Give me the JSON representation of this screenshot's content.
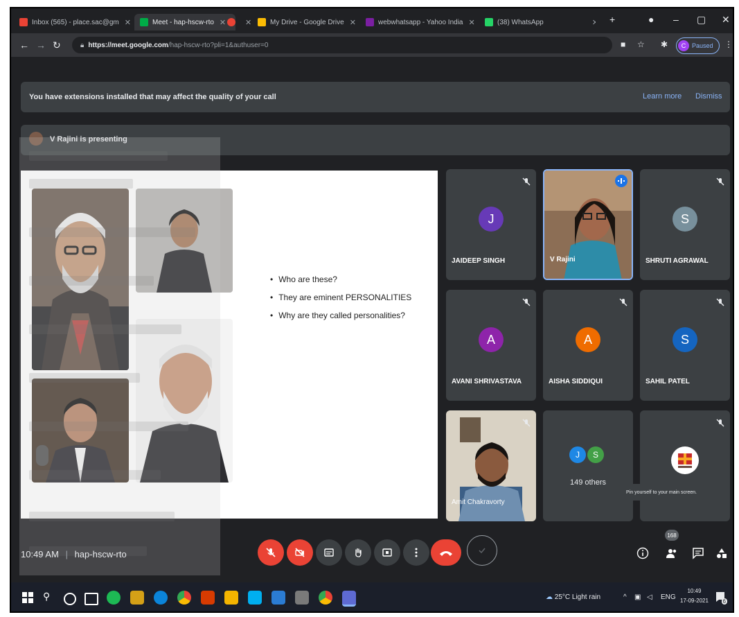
{
  "browser": {
    "tabs": [
      {
        "label": "Inbox (565) - place.sac@gm",
        "color": "#ea4335"
      },
      {
        "label": "Meet - hap-hscw-rto",
        "color": "#00ac47"
      },
      {
        "label": "",
        "color": "#ea4335"
      },
      {
        "label": "My Drive - Google Drive",
        "color": "#fbbc04"
      },
      {
        "label": "webwhatsapp - Yahoo India",
        "color": "#7b1fa2"
      },
      {
        "label": "(38) WhatsApp",
        "color": "#25d366"
      }
    ],
    "url_host": "https://meet.google.com",
    "url_path": "/hap-hscw-rto?pli=1&authuser=0",
    "profile_initial": "C",
    "profile_label": "Paused"
  },
  "banner": {
    "message": "You have extensions installed that may affect the quality of your call",
    "learn_more": "Learn more",
    "dismiss": "Dismiss"
  },
  "presenting": "V Rajini is presenting",
  "slide": {
    "bullets": [
      "Who are these?",
      "They are eminent PERSONALITIES",
      "Why are they called personalities?"
    ]
  },
  "participants": [
    {
      "name": "JAIDEEP SINGH",
      "initial": "J",
      "color": "#673ab7",
      "type": "avatar"
    },
    {
      "name": "V Rajini",
      "initial": "",
      "color": "",
      "type": "video"
    },
    {
      "name": "SHRUTI AGRAWAL",
      "initial": "S",
      "color": "#78909c",
      "type": "avatar"
    },
    {
      "name": "AVANI SHRIVASTAVA",
      "initial": "A",
      "color": "#8e24aa",
      "type": "avatar"
    },
    {
      "name": "AISHA SIDDIQUI",
      "initial": "A",
      "color": "#ef6c00",
      "type": "avatar"
    },
    {
      "name": "SAHIL PATEL",
      "initial": "S",
      "color": "#1565c0",
      "type": "avatar"
    },
    {
      "name": "Amit Chakravorty",
      "initial": "",
      "color": "",
      "type": "video"
    },
    {
      "name": "149 others",
      "initial": "",
      "color": "",
      "type": "others"
    },
    {
      "name": "",
      "initial": "",
      "color": "",
      "type": "logo"
    }
  ],
  "others_avatars": [
    {
      "initial": "J",
      "color": "#1e88e5"
    },
    {
      "initial": "S",
      "color": "#43a047"
    }
  ],
  "tooltip": "Pin yourself to your main screen.",
  "meeting": {
    "time": "10:49 AM",
    "separator": "|",
    "code": "hap-hscw-rto",
    "participant_count": "168"
  },
  "colors": {
    "danger": "#ea4335",
    "control": "#3c4043",
    "accent": "#8ab4f8"
  },
  "taskbar": {
    "weather": "25°C  Light rain",
    "lang": "ENG",
    "clock_time": "10:49",
    "clock_date": "17-09-2021",
    "notifications": "6"
  }
}
